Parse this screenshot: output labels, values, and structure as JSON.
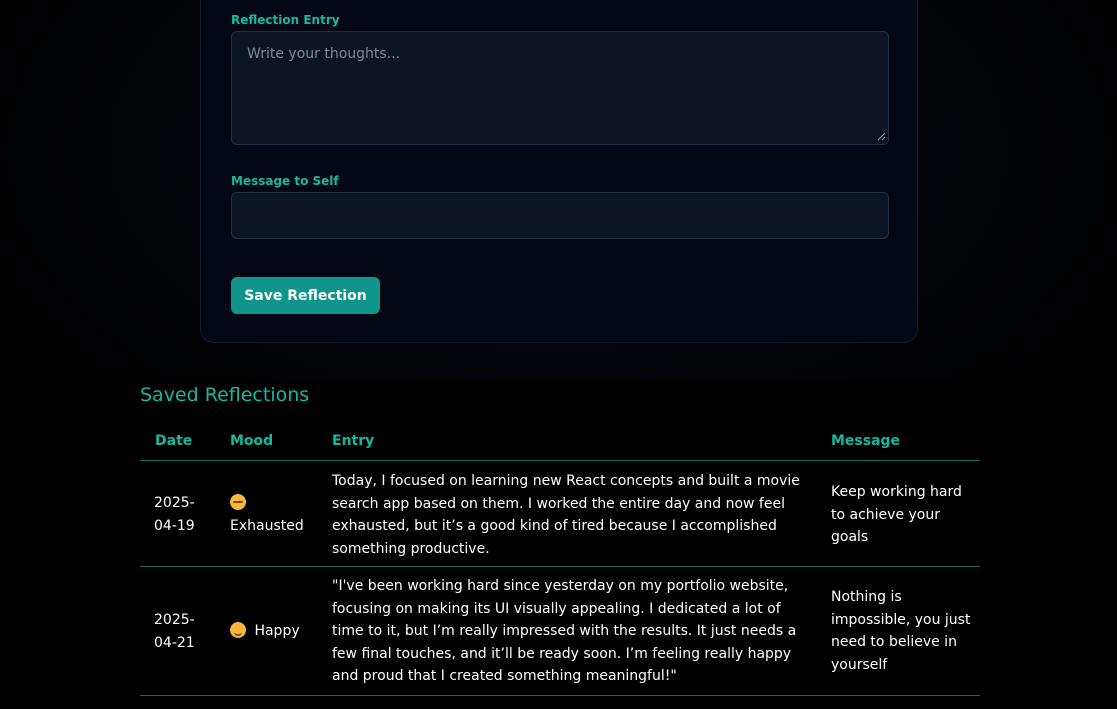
{
  "form": {
    "reflection_label": "Reflection Entry",
    "reflection_placeholder": "Write your thoughts...",
    "message_label": "Message to Self",
    "message_value": "",
    "save_button": "Save Reflection"
  },
  "saved": {
    "title": "Saved Reflections",
    "columns": [
      "Date",
      "Mood",
      "Entry",
      "Message"
    ],
    "rows": [
      {
        "date_line1": "2025-",
        "date_line2": "04-19",
        "mood_icon": "sleepy-face-icon",
        "mood": "Exhausted",
        "entry": "Today, I focused on learning new React concepts and built a movie search app based on them. I worked the entire day and now feel exhausted, but it’s a good kind of tired because I accomplished something productive.",
        "message": "Keep working hard to achieve your goals"
      },
      {
        "date_line1": "2025-",
        "date_line2": "04-21",
        "mood_icon": "smiling-face-icon",
        "mood": "Happy",
        "entry": "\"I've been working hard since yesterday on my portfolio website, focusing on making its UI visually appealing. I dedicated a lot of time to it, but I’m really impressed with the results. It just needs a few final touches, and it’ll be ready soon. I’m feeling really happy and proud that I created something meaningful!\"",
        "message": "Nothing is impossible, you just need to believe in yourself"
      }
    ]
  },
  "colors": {
    "accent": "#17b8a0",
    "button": "#0f958a",
    "card_bg": "#030814",
    "input_bg": "#0c1323",
    "divider": "#136b66"
  }
}
